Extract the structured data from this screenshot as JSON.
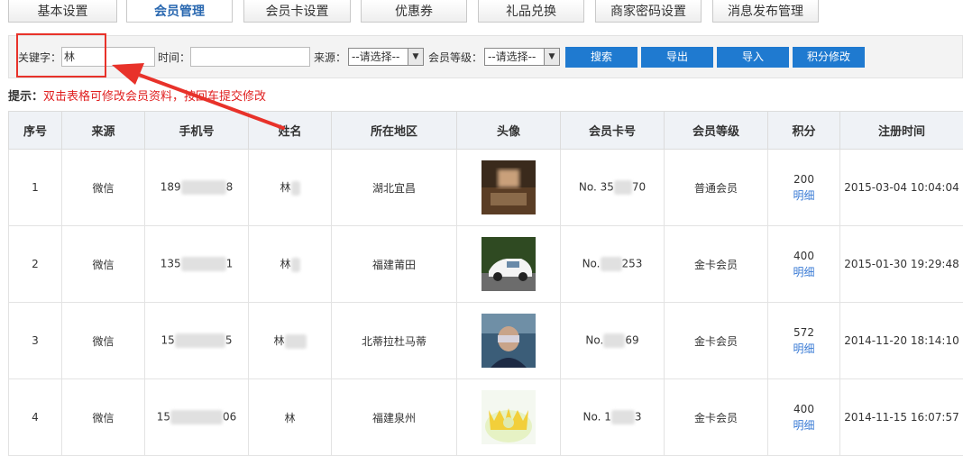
{
  "tabs": [
    {
      "label": "基本设置",
      "active": false
    },
    {
      "label": "会员管理",
      "active": true
    },
    {
      "label": "会员卡设置",
      "active": false
    },
    {
      "label": "优惠券",
      "active": false
    },
    {
      "label": "礼品兑换",
      "active": false
    },
    {
      "label": "商家密码设置",
      "active": false
    },
    {
      "label": "消息发布管理",
      "active": false
    }
  ],
  "filter": {
    "keyword_label": "关键字：",
    "keyword_value": "林",
    "time_label": "时间：",
    "time_value": "",
    "source_label": "来源：",
    "source_value": "--请选择--",
    "level_label": "会员等级：",
    "level_value": "--请选择--",
    "search": "搜索",
    "export": "导出",
    "import": "导入",
    "points_edit": "积分修改"
  },
  "hint": {
    "prefix": "提示：",
    "text": "双击表格可修改会员资料，按回车提交修改"
  },
  "table": {
    "headers": [
      "序号",
      "来源",
      "手机号",
      "姓名",
      "所在地区",
      "头像",
      "会员卡号",
      "会员等级",
      "积分",
      "注册时间"
    ],
    "detail_label": "明细",
    "rows": [
      {
        "no": "1",
        "source": "微信",
        "phone_a": "189",
        "phone_b": "8",
        "name_a": "林",
        "name_b": "",
        "region": "湖北宜昌",
        "card_a": "No. 35",
        "card_b": "70",
        "level": "普通会员",
        "points": "200",
        "reg_time": "2015-03-04 10:04:04"
      },
      {
        "no": "2",
        "source": "微信",
        "phone_a": "135",
        "phone_b": "1",
        "name_a": "林",
        "name_b": "",
        "region": "福建莆田",
        "card_a": "No.",
        "card_b": "253",
        "level": "金卡会员",
        "points": "400",
        "reg_time": "2015-01-30 19:29:48"
      },
      {
        "no": "3",
        "source": "微信",
        "phone_a": "15",
        "phone_b": "5",
        "name_a": "林",
        "name_b": "",
        "region": "北蒂拉杜马蒂",
        "card_a": "No.",
        "card_b": "69",
        "level": "金卡会员",
        "points": "572",
        "reg_time": "2014-11-20 18:14:10"
      },
      {
        "no": "4",
        "source": "微信",
        "phone_a": "15",
        "phone_b": "06",
        "name_a": "林",
        "name_b": "",
        "region": "福建泉州",
        "card_a": "No. 1",
        "card_b": "3",
        "level": "金卡会员",
        "points": "400",
        "reg_time": "2014-11-15 16:07:57"
      }
    ]
  },
  "colors": {
    "accent": "#1f7ad0",
    "highlight": "#e8322a",
    "header_bg": "#eff2f6"
  }
}
